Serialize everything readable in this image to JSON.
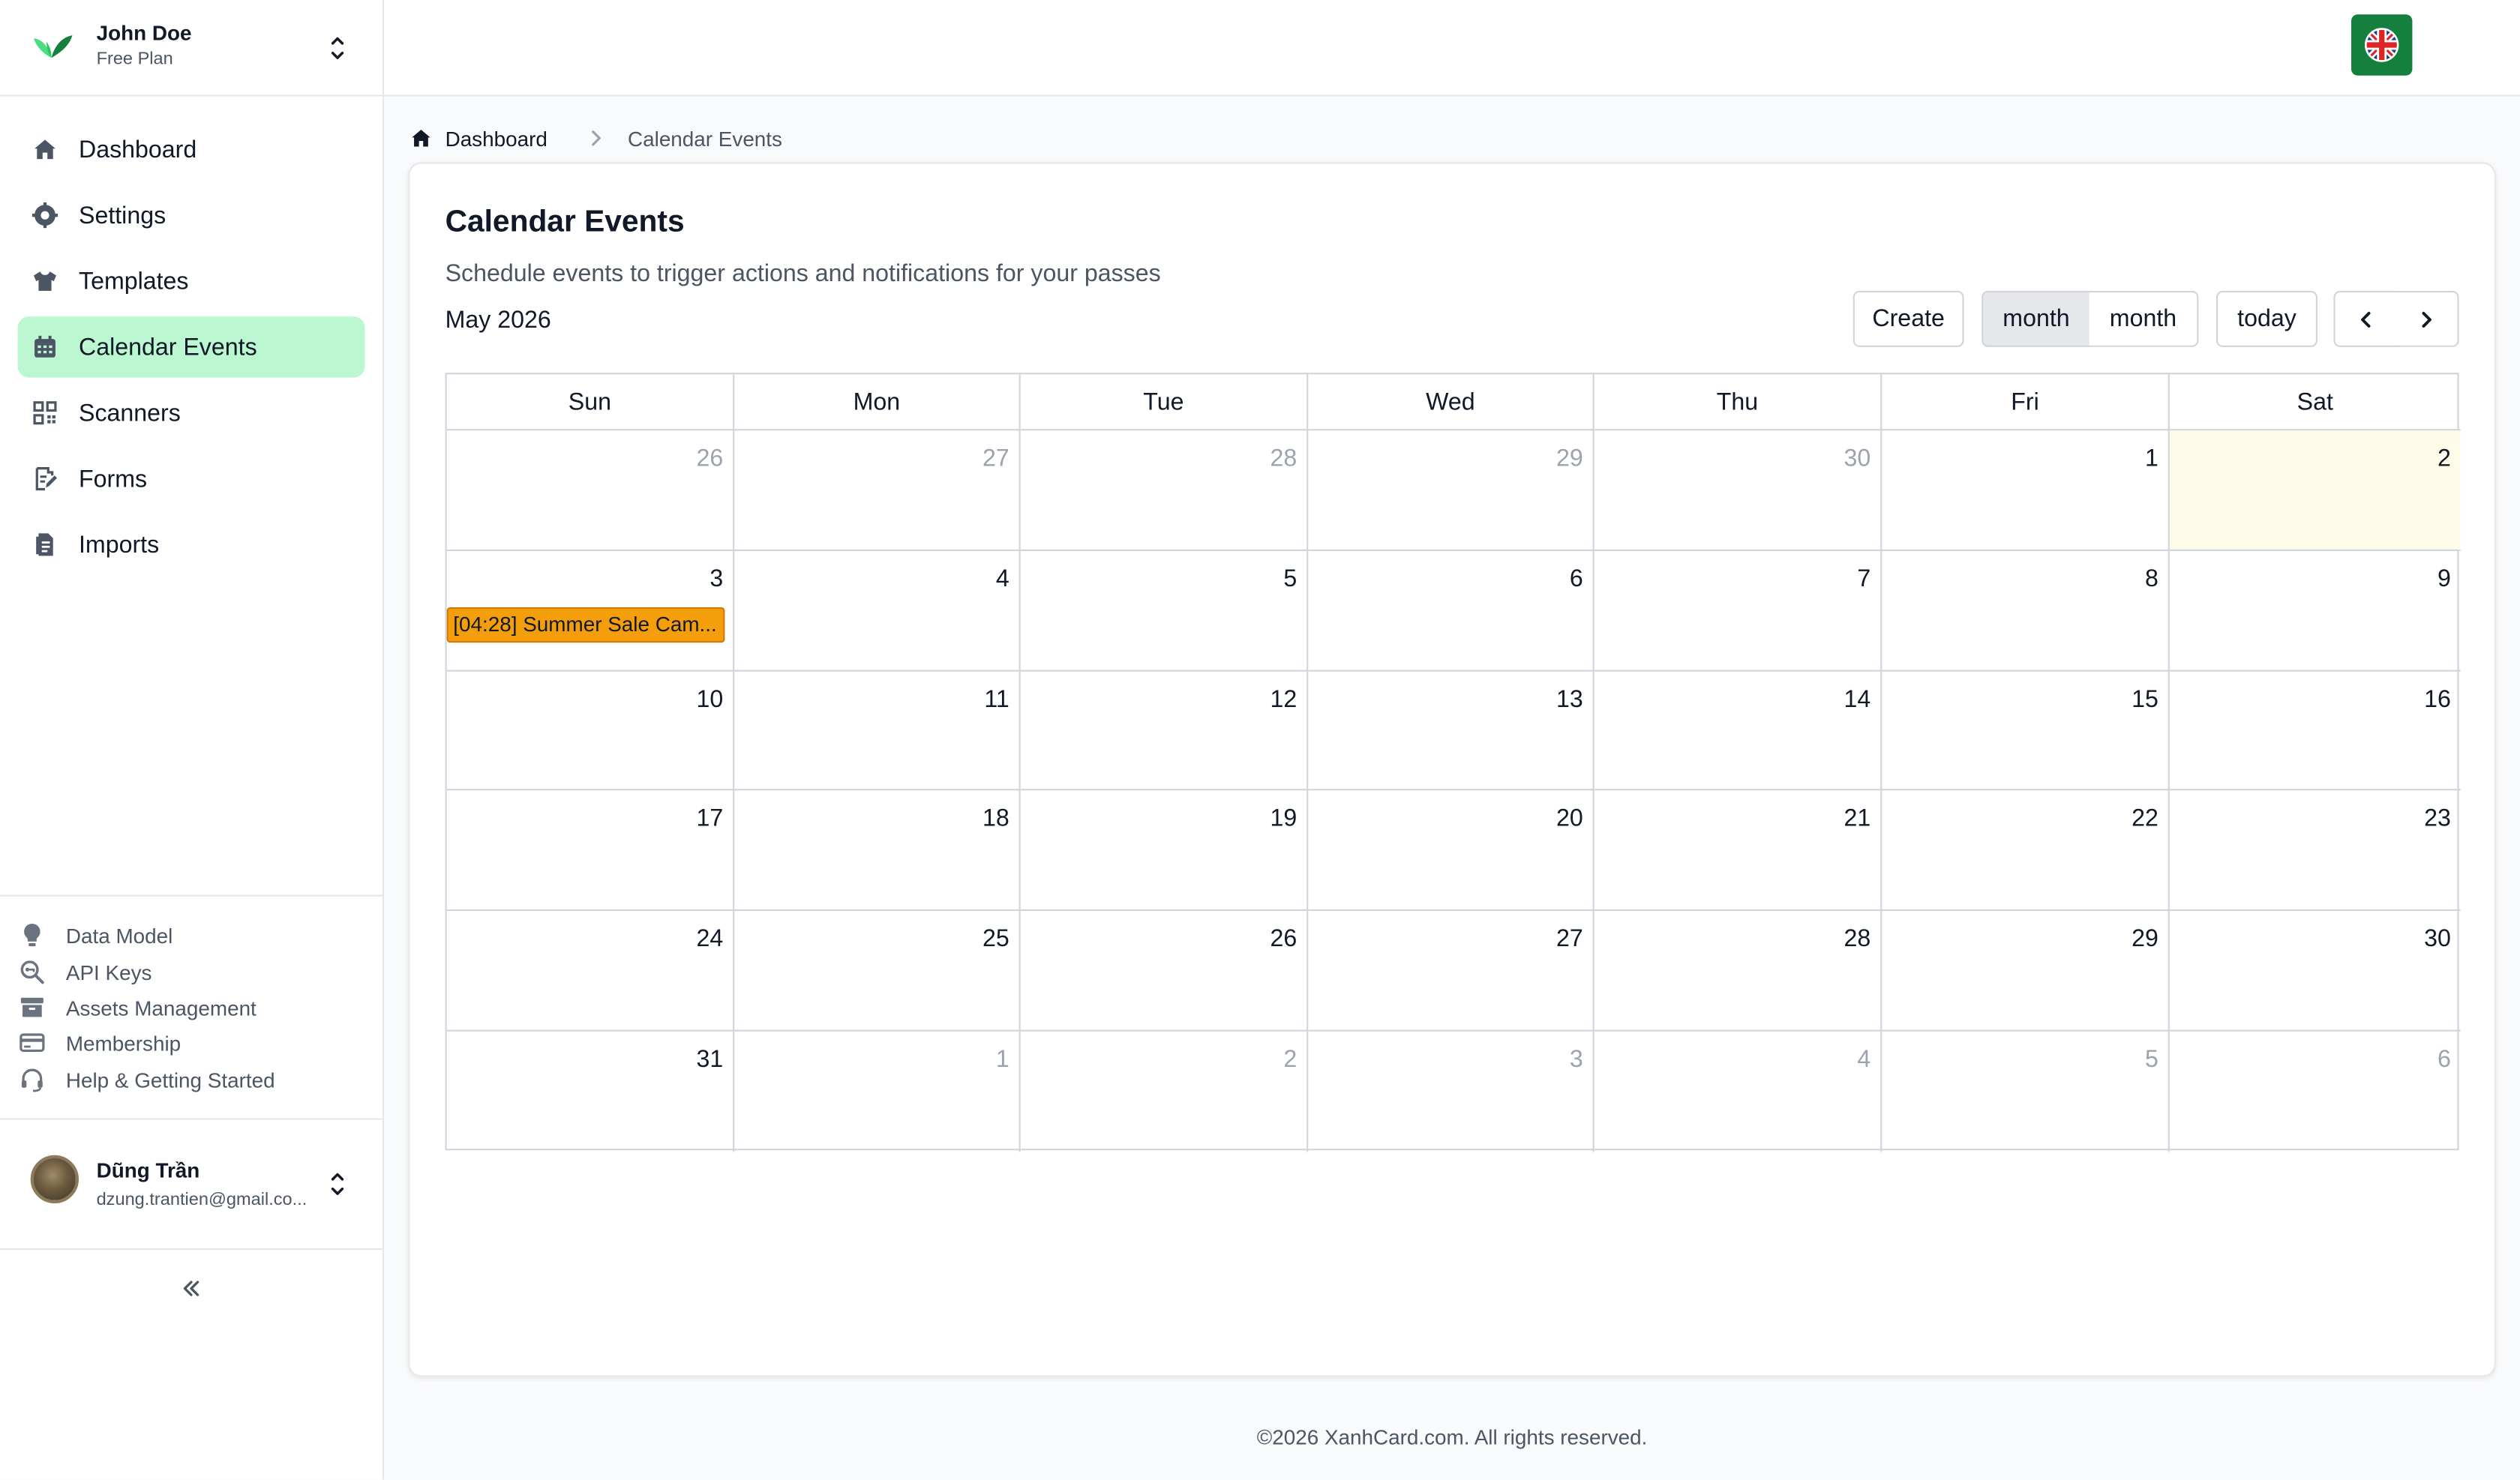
{
  "account": {
    "name": "John Doe",
    "plan": "Free Plan"
  },
  "nav": [
    {
      "label": "Dashboard",
      "icon": "home-icon"
    },
    {
      "label": "Settings",
      "icon": "gear-icon"
    },
    {
      "label": "Templates",
      "icon": "shirt-icon"
    },
    {
      "label": "Calendar Events",
      "icon": "calendar-icon",
      "active": true
    },
    {
      "label": "Scanners",
      "icon": "qr-icon"
    },
    {
      "label": "Forms",
      "icon": "form-edit-icon"
    },
    {
      "label": "Imports",
      "icon": "file-import-icon"
    }
  ],
  "secondary": [
    {
      "label": "Data Model",
      "icon": "lightbulb-icon"
    },
    {
      "label": "API Keys",
      "icon": "key-search-icon"
    },
    {
      "label": "Assets Management",
      "icon": "archive-icon"
    },
    {
      "label": "Membership",
      "icon": "card-icon"
    },
    {
      "label": "Help & Getting Started",
      "icon": "headset-icon"
    }
  ],
  "user": {
    "name": "Dũng Trần",
    "email": "dzung.trantien@gmail.co..."
  },
  "breadcrumb": {
    "home": "Dashboard",
    "current": "Calendar Events"
  },
  "page": {
    "title": "Calendar Events",
    "subtitle": "Schedule events to trigger actions and notifications for your passes",
    "month_label": "May 2026"
  },
  "toolbar": {
    "create": "Create",
    "view_a": "month",
    "view_b": "month",
    "today": "today"
  },
  "calendar": {
    "weekdays": [
      "Sun",
      "Mon",
      "Tue",
      "Wed",
      "Thu",
      "Fri",
      "Sat"
    ],
    "weeks": [
      [
        "26",
        "27",
        "28",
        "29",
        "30",
        "1",
        "2"
      ],
      [
        "3",
        "4",
        "5",
        "6",
        "7",
        "8",
        "9"
      ],
      [
        "10",
        "11",
        "12",
        "13",
        "14",
        "15",
        "16"
      ],
      [
        "17",
        "18",
        "19",
        "20",
        "21",
        "22",
        "23"
      ],
      [
        "24",
        "25",
        "26",
        "27",
        "28",
        "29",
        "30"
      ],
      [
        "31",
        "1",
        "2",
        "3",
        "4",
        "5",
        "6"
      ]
    ],
    "event": "[04:28] Summer Sale Cam..."
  },
  "footer": "©2026 XanhCard.com. All rights reserved.",
  "colors": {
    "active_nav": "#bbf7d0",
    "event": "#f59e0b",
    "today_bg": "#fefce8",
    "brand": "#15803d"
  }
}
